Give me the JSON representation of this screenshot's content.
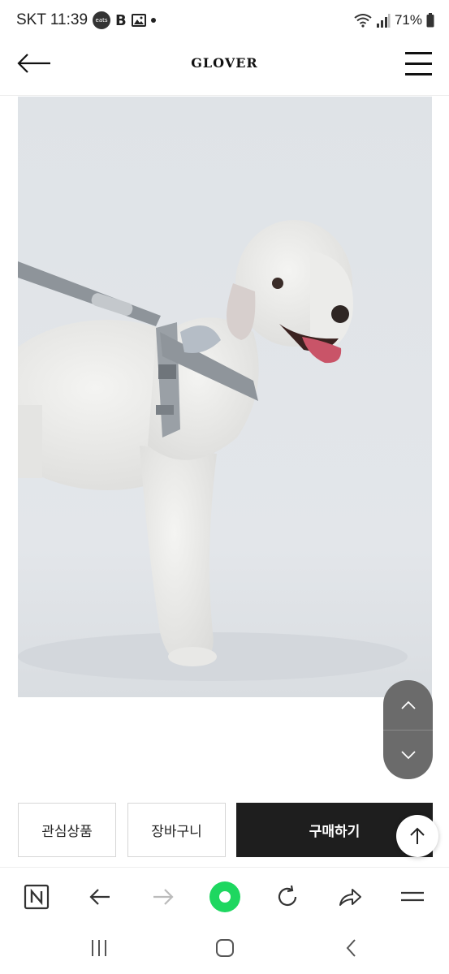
{
  "status_bar": {
    "time": "SKT 11:39",
    "eats_icon_text": "eats",
    "battery": "71%",
    "icons": [
      "eats-icon",
      "b-app-icon",
      "gallery-icon",
      "notification-dot-icon",
      "wifi-icon",
      "signal-icon",
      "battery-icon"
    ]
  },
  "header": {
    "brand": "GLOVER",
    "back_icon": "arrow-left-icon",
    "menu_icon": "hamburger-menu-icon"
  },
  "product": {
    "image_subject": "dog-harness-product-photo"
  },
  "scroll_control": {
    "up_icon": "chevron-up-icon",
    "down_icon": "chevron-down-icon"
  },
  "actions": {
    "wishlist_label": "관심상품",
    "cart_label": "장바구니",
    "buy_label": "구매하기",
    "to_top_icon": "arrow-up-icon"
  },
  "browser_toolbar": {
    "items": [
      "naver-n-icon",
      "back-arrow-icon",
      "forward-arrow-icon",
      "green-home-icon",
      "refresh-icon",
      "share-icon",
      "menu-icon"
    ]
  },
  "system_nav": {
    "items": [
      "recent-apps-icon",
      "home-icon",
      "back-icon"
    ]
  },
  "colors": {
    "buy_button_bg": "#1e1e1e",
    "scroll_control_bg": "#6b6b6b",
    "home_green": "#1ed760"
  }
}
